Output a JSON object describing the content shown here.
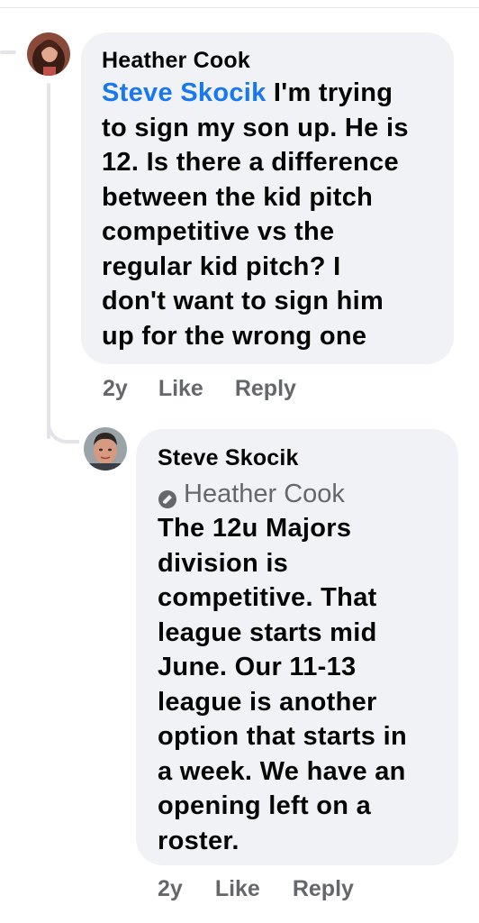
{
  "comment1": {
    "author": "Heather Cook",
    "mention": "Steve Skocik",
    "text_lines": [
      " I'm trying",
      "to sign my son up. He is",
      "12. Is there a difference",
      "between the kid pitch",
      "competitive vs the",
      "regular kid pitch? I",
      "don't want to sign him",
      "up for the wrong one"
    ],
    "time": "2y",
    "like_label": "Like",
    "reply_label": "Reply"
  },
  "comment2": {
    "author": "Steve Skocik",
    "reply_to": "Heather Cook",
    "reply_icon": "reply-tag-icon",
    "text_lines": [
      "The 12u Majors",
      "division is",
      "competitive. That",
      "league starts mid",
      "June.  Our 11-13",
      "league is another",
      "option that starts in",
      "a week.  We have an",
      "opening left on a",
      "roster."
    ],
    "time": "2y",
    "like_label": "Like",
    "reply_label": "Reply"
  },
  "colors": {
    "bubble": "#f0f2f5",
    "mention": "#1877f2",
    "meta": "#65676b",
    "text": "#050505"
  }
}
